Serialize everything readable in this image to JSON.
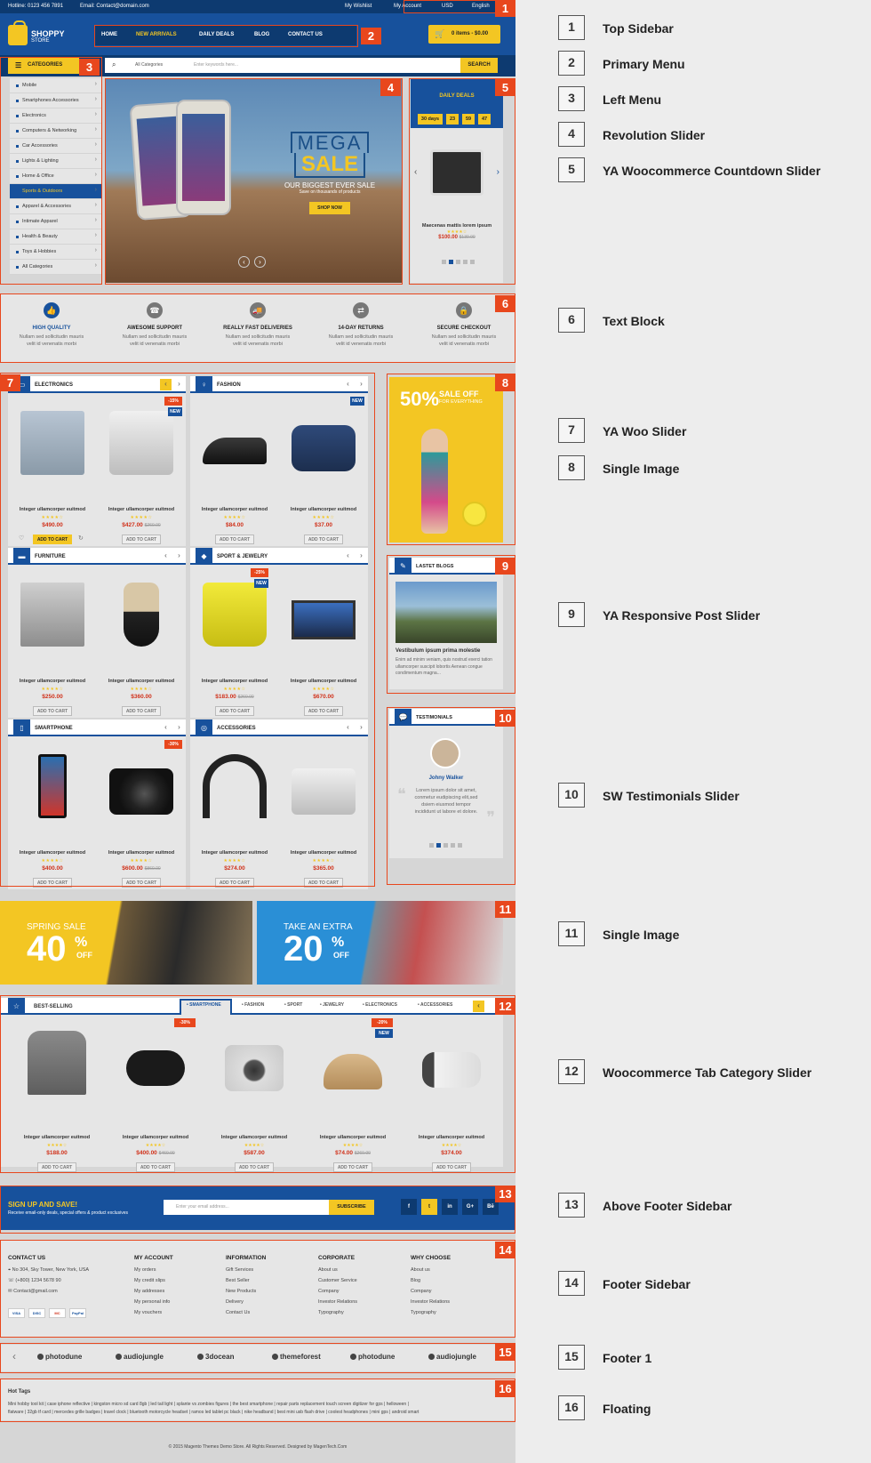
{
  "topbar": {
    "hotline": "Hotline: 0123 456 7891",
    "email": "Email: Contact@domain.com",
    "wishlist": "My Wishlist",
    "account": "My Account",
    "currency": "USD",
    "language": "English"
  },
  "header": {
    "logo_title": "SHOPPY",
    "logo_sub": "STORE",
    "menu": [
      "HOME",
      "NEW ARRIVALS",
      "DAILY DEALS",
      "BLOG",
      "CONTACT US"
    ],
    "cart": "0 items - $0.00"
  },
  "search": {
    "categories_label": "CATEGORIES",
    "all_categories": "All Categories",
    "placeholder": "Enter keywords here...",
    "button": "SEARCH"
  },
  "left_menu": [
    "Mobile",
    "Smartphones Accessories",
    "Electronics",
    "Computers & Networking",
    "Car Accessories",
    "Lights & Lighting",
    "Home & Office",
    "Sports & Outdoors",
    "Apparel & Accessories",
    "Intimate Apparel",
    "Health & Beauty",
    "Toys & Hobbies",
    "All Categories"
  ],
  "slider": {
    "line1": "MEGA",
    "line2": "SALE",
    "line3": "OUR BIGGEST EVER SALE",
    "line4": "Save on thousands of products",
    "button": "SHOP NOW"
  },
  "deals": {
    "title": "DAILY DEALS",
    "countdown": [
      "30 days",
      "23",
      "59",
      "47"
    ],
    "product": "Maecenas mattis lorem ipsum",
    "price": "$100.00",
    "old_price": "$130.00"
  },
  "features": [
    {
      "title": "HIGH QUALITY",
      "desc": "Nullam sed sollicitudin mauris velit id venenatis morbi"
    },
    {
      "title": "AWESOME SUPPORT",
      "desc": "Nullam sed sollicitudin mauris velit id venenatis morbi"
    },
    {
      "title": "REALLY FAST DELIVERIES",
      "desc": "Nullam sed sollicitudin mauris velit id venenatis morbi"
    },
    {
      "title": "14-DAY RETURNS",
      "desc": "Nullam sed sollicitudin mauris velit id venenatis morbi"
    },
    {
      "title": "SECURE CHECKOUT",
      "desc": "Nullam sed sollicitudin mauris velit id venenatis morbi"
    }
  ],
  "product_name": "Integer ullamcorper euitmod",
  "add_to_cart": "ADD TO CART",
  "rating": "★★★★☆",
  "boxes": [
    {
      "title": "ELECTRONICS",
      "items": [
        {
          "price": "$490.00",
          "old": ""
        },
        {
          "price": "$427.00",
          "old": "$260.00",
          "sale": "-15%",
          "new": "NEW"
        }
      ]
    },
    {
      "title": "FASHION",
      "items": [
        {
          "price": "$84.00",
          "old": ""
        },
        {
          "price": "$37.00",
          "old": "",
          "new": "NEW"
        }
      ]
    },
    {
      "title": "FURNITURE",
      "items": [
        {
          "price": "$250.00",
          "old": ""
        },
        {
          "price": "$360.00",
          "old": ""
        }
      ]
    },
    {
      "title": "SPORT & JEWELRY",
      "items": [
        {
          "price": "$183.00",
          "old": "$260.00",
          "sale": "-25%",
          "new": "NEW"
        },
        {
          "price": "$670.00",
          "old": ""
        }
      ]
    },
    {
      "title": "SMARTPHONE",
      "items": [
        {
          "price": "$400.00",
          "old": ""
        },
        {
          "price": "$600.00",
          "old": "$860.00",
          "sale": "-30%"
        }
      ]
    },
    {
      "title": "ACCESSORIES",
      "items": [
        {
          "price": "$274.00",
          "old": ""
        },
        {
          "price": "$365.00",
          "old": ""
        }
      ]
    }
  ],
  "kid_banner": {
    "big": "50%",
    "sale": "SALE OFF",
    "sub": "FOR EVERYTHING"
  },
  "blogs": {
    "title": "LASTET BLOGS",
    "post": "Vestibulum ipsum prima molestie",
    "text": "Enim ad minim veniam, quis nostrud exerci tation ullamcorper suscipit lobortis Aenean congue condimentum magna..."
  },
  "testimonials": {
    "title": "TESTIMONIALS",
    "name": "Johny Walker",
    "quote": "Lorem ipsum dolor sit amet, conmetur eudipiscing elit,sed dsiem eiusmod tempor incididunt ut labore et dolore."
  },
  "banners": [
    {
      "l1": "SPRING SALE",
      "l2": "40",
      "l3": "%",
      "l4": "OFF"
    },
    {
      "l1": "TAKE AN EXTRA",
      "l2": "20",
      "l3": "%",
      "l4": "OFF"
    }
  ],
  "best": {
    "title": "BEST-SELLING",
    "tabs": [
      "• SMARTPHONE",
      "• FASHION",
      "• SPORT",
      "• JEWELRY",
      "• ELECTRONICS",
      "• ACCESSORIES"
    ],
    "items": [
      {
        "price": "$188.00",
        "old": ""
      },
      {
        "price": "$400.00",
        "old": "$460.00",
        "sale": "-30%"
      },
      {
        "price": "$587.00",
        "old": ""
      },
      {
        "price": "$74.00",
        "old": "$260.00",
        "sale": "-20%",
        "new": "NEW"
      },
      {
        "price": "$374.00",
        "old": ""
      }
    ]
  },
  "newsletter": {
    "title": "SIGN UP AND SAVE!",
    "sub": "Receive email-only deals, special offers & product exclusives",
    "placeholder": "Enter your email address...",
    "button": "SUBSCRIBE",
    "social": [
      "f",
      "t",
      "in",
      "G+",
      "Bē"
    ]
  },
  "footer": {
    "contact_title": "CONTACT US",
    "contact": [
      "No 304, Sky Tower, New York, USA",
      "(+800) 1234 5678 90",
      "Contact@gmail.com"
    ],
    "payments": [
      "VISA",
      "DISC",
      "MC",
      "PayPal"
    ],
    "columns": [
      {
        "title": "MY ACCOUNT",
        "links": [
          "My orders",
          "My credit slips",
          "My addresses",
          "My personal info",
          "My vouchers"
        ]
      },
      {
        "title": "INFORMATION",
        "links": [
          "Gift Services",
          "Best Seller",
          "New Products",
          "Delivery",
          "Contact Us"
        ]
      },
      {
        "title": "CORPORATE",
        "links": [
          "About us",
          "Customer Service",
          "Company",
          "Investor Relations",
          "Typography"
        ]
      },
      {
        "title": "WHY CHOOSE",
        "links": [
          "About us",
          "Blog",
          "Company",
          "Investor Relations",
          "Typography"
        ]
      }
    ]
  },
  "brands": [
    "photodune",
    "audiojungle",
    "3docean",
    "themeforest",
    "photodune",
    "audiojungle"
  ],
  "hot_tags": {
    "title": "Hot Tags",
    "line1": "Mini hobby tool kit | case iphone reflective | kingston micro sd card 8gb | led tail light | splante vs zombies figures | the best smartphone | repair parts replacement touch screen digitizer for gps | helloween |",
    "line2": "flatware | 32gb tf card | mercedes grille badges | travel clock | bluetooth motorcycle headset | ramos led tablet pc black | nike headband | best mini usb flash drive | coolest headphones | mini gps | android smart"
  },
  "copyright": "© 2015 Magento Themes Demo Store. All Rights Reserved. Designed by MagenTech.Com",
  "legend": [
    {
      "num": "1",
      "label": "Top Sidebar"
    },
    {
      "num": "2",
      "label": "Primary Menu"
    },
    {
      "num": "3",
      "label": "Left Menu"
    },
    {
      "num": "4",
      "label": "Revolution Slider"
    },
    {
      "num": "5",
      "label": "YA Woocommerce Countdown Slider"
    },
    {
      "num": "6",
      "label": "Text Block"
    },
    {
      "num": "7",
      "label": "YA Woo Slider"
    },
    {
      "num": "8",
      "label": "Single Image"
    },
    {
      "num": "9",
      "label": "YA Responsive Post Slider"
    },
    {
      "num": "10",
      "label": "SW Testimonials Slider"
    },
    {
      "num": "11",
      "label": "Single Image"
    },
    {
      "num": "12",
      "label": "Woocommerce Tab Category Slider"
    },
    {
      "num": "13",
      "label": "Above Footer Sidebar"
    },
    {
      "num": "14",
      "label": "Footer Sidebar"
    },
    {
      "num": "15",
      "label": "Footer 1"
    },
    {
      "num": "16",
      "label": "Floating"
    }
  ],
  "colors": {
    "brand_blue": "#17519c",
    "dark_blue": "#0d3a70",
    "accent_yellow": "#f3c623",
    "marker_orange": "#e8471d",
    "price_red": "#d0311a"
  }
}
